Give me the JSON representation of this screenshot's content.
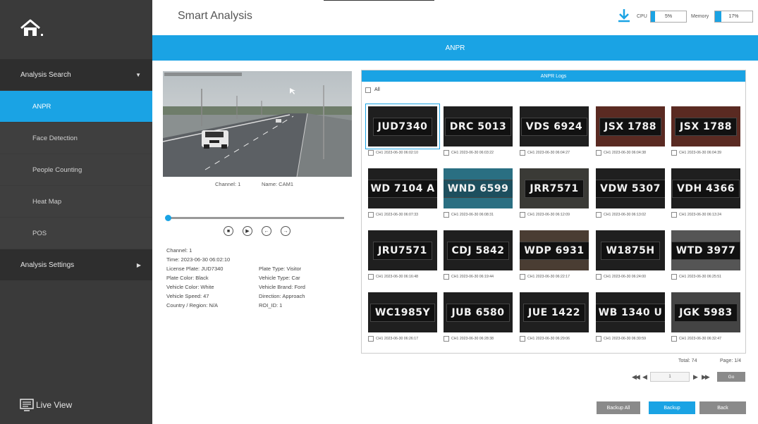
{
  "sidebar": {
    "home_icon": "home-icon",
    "analysis_search": "Analysis Search",
    "items": [
      "ANPR",
      "Face Detection",
      "People Counting",
      "Heat Map",
      "POS"
    ],
    "analysis_settings": "Analysis Settings",
    "live_view": "Live View"
  },
  "header": {
    "title": "Smart Analysis",
    "cpu_label": "CPU",
    "cpu_value": "5%",
    "cpu_percent": 5,
    "memory_label": "Memory",
    "memory_value": "17%",
    "memory_percent": 17
  },
  "banner": {
    "title": "ANPR"
  },
  "player": {
    "channel_caption": "Channel: 1",
    "name_caption": "Name: CAM1",
    "progress_fraction": 0.0,
    "controls": [
      "stop-icon",
      "play-icon",
      "previous-icon",
      "next-icon"
    ]
  },
  "details": {
    "channel": "Channel: 1",
    "time": "Time: 2023-06-30 06:02:10",
    "license_plate": "License Plate: JUD7340",
    "plate_type": "Plate Type: Visitor",
    "plate_color": "Plate Color: Black",
    "vehicle_type": "Vehicle Type: Car",
    "vehicle_color": "Vehicle Color: White",
    "vehicle_brand": "Vehicle Brand: Ford",
    "vehicle_speed": "Vehicle Speed: 47",
    "direction": "Direction: Approach",
    "country": "Country / Region: N/A",
    "roi": "ROI_ID: 1"
  },
  "logs": {
    "header": "ANPR Logs",
    "all_label": "All",
    "items": [
      {
        "plate": "JUD7340",
        "caption": "CH1  2023-06-30 06:02:10"
      },
      {
        "plate": "DRC 5013",
        "caption": "CH1  2023-06-30 06:03:22"
      },
      {
        "plate": "VDS 6924",
        "caption": "CH1  2023-06-30 06:04:27"
      },
      {
        "plate": "JSX 1788",
        "caption": "CH1  2023-06-30 06:04:38"
      },
      {
        "plate": "JSX 1788",
        "caption": "CH1  2023-06-30 06:04:39"
      },
      {
        "plate": "WD 7104 A",
        "caption": "CH1  2023-06-30 06:07:33"
      },
      {
        "plate": "WND 6599",
        "caption": "CH1  2023-06-30 06:08:31"
      },
      {
        "plate": "JRR7571",
        "caption": "CH1  2023-06-30 06:12:09"
      },
      {
        "plate": "VDW 5307",
        "caption": "CH1  2023-06-30 06:13:02"
      },
      {
        "plate": "VDH 4366",
        "caption": "CH1  2023-06-30 06:13:24"
      },
      {
        "plate": "JRU7571",
        "caption": "CH1  2023-06-30 06:16:48"
      },
      {
        "plate": "CDJ 5842",
        "caption": "CH1  2023-06-30 06:19:44"
      },
      {
        "plate": "WDP 6931",
        "caption": "CH1  2023-06-30 06:22:17"
      },
      {
        "plate": "W1875H",
        "caption": "CH1  2023-06-30 06:24:00"
      },
      {
        "plate": "WTD 3977",
        "caption": "CH1  2023-06-30 06:25:51"
      },
      {
        "plate": "WC1985Y",
        "caption": "CH1  2023-06-30 06:26:17"
      },
      {
        "plate": "JUB 6580",
        "caption": "CH1  2023-06-30 06:28:38"
      },
      {
        "plate": "JUE 1422",
        "caption": "CH1  2023-06-30 06:29:06"
      },
      {
        "plate": "WB 1340 U",
        "caption": "CH1  2023-06-30 06:30:59"
      },
      {
        "plate": "JGK 5983",
        "caption": "CH1  2023-06-30 06:32:47"
      }
    ]
  },
  "pagination": {
    "total": "Total: 74",
    "page": "Page: 1/4",
    "current_page": "1",
    "go": "Go"
  },
  "footer": {
    "backup_all": "Backup All",
    "backup": "Backup",
    "back": "Back"
  },
  "colors": {
    "accent": "#1aa3e4",
    "sidebar": "#3a3a3a"
  }
}
